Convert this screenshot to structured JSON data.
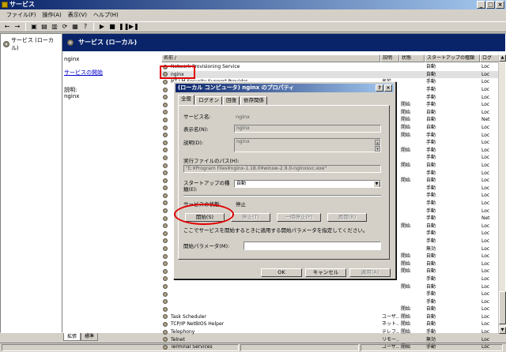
{
  "window": {
    "title": "サービス",
    "buttons": [
      "_",
      "□",
      "×"
    ]
  },
  "menu": [
    "ファイル(F)",
    "操作(A)",
    "表示(V)",
    "ヘルプ(H)"
  ],
  "toolbar_icons": [
    "back-icon",
    "forward-icon",
    "up-icon",
    "tree-icon",
    "properties-icon",
    "refresh-icon",
    "export-icon",
    "help-icon",
    "play-icon",
    "stop-icon",
    "pause-icon",
    "restart-icon"
  ],
  "tree": {
    "root": "サービス (ローカル)"
  },
  "pane": {
    "header": "サービス (ローカル)"
  },
  "extended": {
    "name": "nginx",
    "start_link": "サービスの開始",
    "desc_label": "説明:",
    "desc_value": "nginx"
  },
  "list": {
    "columns": [
      "名前 /",
      "説明",
      "状態",
      "スタートアップの種類",
      "ログ"
    ],
    "rows": [
      [
        "Network Provisioning Service",
        "",
        "",
        "自動",
        "Loc"
      ],
      [
        "nginx",
        "",
        "",
        "自動",
        "Loc"
      ],
      [
        "NT LM Security Support Provider",
        "名前",
        "",
        "手動",
        "Loc"
      ],
      [
        "",
        "",
        "",
        "手動",
        "Loc"
      ],
      [
        "",
        "",
        "",
        "手動",
        "Loc"
      ],
      [
        "",
        "",
        "開始",
        "手動",
        "Loc"
      ],
      [
        "",
        "",
        "開始",
        "自動",
        "Loc"
      ],
      [
        "",
        "",
        "開始",
        "自動",
        "Net"
      ],
      [
        "",
        "",
        "開始",
        "自動",
        "Loc"
      ],
      [
        "",
        "",
        "開始",
        "手動",
        "Loc"
      ],
      [
        "",
        "",
        "",
        "手動",
        "Loc"
      ],
      [
        "",
        "",
        "開始",
        "手動",
        "Loc"
      ],
      [
        "",
        "",
        "",
        "手動",
        "Loc"
      ],
      [
        "",
        "",
        "開始",
        "自動",
        "Loc"
      ],
      [
        "",
        "",
        "",
        "手動",
        "Loc"
      ],
      [
        "",
        "",
        "開始",
        "自動",
        "Loc"
      ],
      [
        "",
        "",
        "",
        "手動",
        "Loc"
      ],
      [
        "",
        "",
        "",
        "手動",
        "Loc"
      ],
      [
        "",
        "",
        "",
        "手動",
        "Loc"
      ],
      [
        "",
        "",
        "",
        "手動",
        "Loc"
      ],
      [
        "",
        "",
        "",
        "手動",
        "Net"
      ],
      [
        "",
        "",
        "開始",
        "自動",
        "Loc"
      ],
      [
        "",
        "",
        "",
        "手動",
        "Loc"
      ],
      [
        "",
        "",
        "",
        "手動",
        "Loc"
      ],
      [
        "",
        "",
        "",
        "無効",
        "Loc"
      ],
      [
        "",
        "",
        "開始",
        "自動",
        "Loc"
      ],
      [
        "",
        "",
        "開始",
        "自動",
        "Loc"
      ],
      [
        "",
        "",
        "開始",
        "自動",
        "Loc"
      ],
      [
        "",
        "",
        "",
        "手動",
        "Loc"
      ],
      [
        "",
        "",
        "開始",
        "自動",
        "Loc"
      ],
      [
        "",
        "",
        "",
        "手動",
        "Loc"
      ],
      [
        "",
        "",
        "",
        "手動",
        "Loc"
      ],
      [
        "",
        "",
        "開始",
        "自動",
        "Loc"
      ],
      [
        "Task Scheduler",
        "ユーザ...",
        "開始",
        "自動",
        "Loc"
      ],
      [
        "TCP/IP NetBIOS Helper",
        "ネット...",
        "開始",
        "自動",
        "Loc"
      ],
      [
        "Telephony",
        "テレフ...",
        "開始",
        "手動",
        "Loc"
      ],
      [
        "Telnet",
        "リモー...",
        "",
        "無効",
        "Loc"
      ],
      [
        "Terminal Services",
        "ユーザ...",
        "開始",
        "手動",
        "Loc"
      ]
    ]
  },
  "bottom_tabs": [
    "拡張",
    "標準"
  ],
  "dialog": {
    "title": "(ローカル コンピュータ) nginx のプロパティ",
    "title_buttons": [
      "?",
      "×"
    ],
    "tabs": [
      "全般",
      "ログオン",
      "回復",
      "依存関係"
    ],
    "service_name_label": "サービス名:",
    "service_name_value": "nginx",
    "display_name_label": "表示名(N):",
    "display_name_value": "nginx",
    "description_label": "説明(D):",
    "description_value": "nginx",
    "exe_path_label": "実行ファイルのパス(H):",
    "exe_path_value": "\"E:¥Program Files¥nginx-1.18.0¥winsw-2.9.0-nginxsvc.exe\"",
    "startup_type_label": "スタートアップの種類(E):",
    "startup_type_value": "自動",
    "status_label": "サービスの状態:",
    "status_value": "停止",
    "start_button": "開始(S)",
    "stop_button": "停止(T)",
    "pause_button": "一時停止(P)",
    "resume_button": "再開(R)",
    "hint_text": "ここでサービスを開始するときに適用する開始パラメータを指定してください。",
    "params_label": "開始パラメータ(M):",
    "params_value": "",
    "ok_button": "OK",
    "cancel_button": "キャンセル",
    "apply_button": "適用(A)"
  },
  "colors": {
    "titlebar": "#0a246a",
    "highlight": "#e00000",
    "face": "#d4d0c8"
  }
}
